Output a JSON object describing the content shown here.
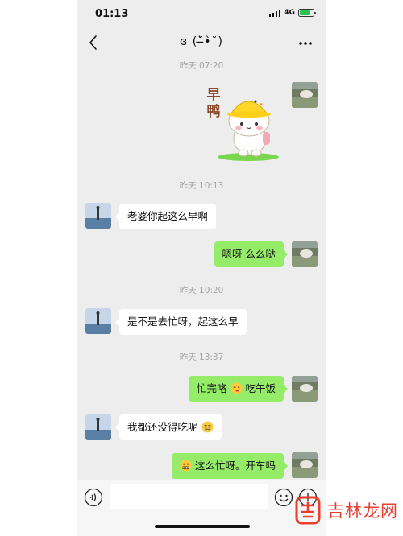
{
  "status_bar": {
    "time": "01:13",
    "network": "4G",
    "battery_level": 0.75
  },
  "nav": {
    "title": "ɞ (˘̶̀•̀˘)"
  },
  "messages": [
    {
      "type": "timestamp",
      "text": "昨天 07:20"
    },
    {
      "type": "sticker",
      "side": "right",
      "sticker_text": "早鸭"
    },
    {
      "type": "timestamp",
      "text": "昨天 10:13"
    },
    {
      "type": "text",
      "side": "left",
      "text": "老婆你起这么早啊"
    },
    {
      "type": "text",
      "side": "right",
      "text": "嗯呀 么么哒"
    },
    {
      "type": "timestamp",
      "text": "昨天 10:20"
    },
    {
      "type": "text",
      "side": "left",
      "text": "是不是去忙呀，起这么早"
    },
    {
      "type": "timestamp",
      "text": "昨天 13:37"
    },
    {
      "type": "text",
      "side": "right",
      "text_before": "忙完咯",
      "emoji": "wink-face",
      "text_after": "吃午饭"
    },
    {
      "type": "text",
      "side": "left",
      "text": "我都还没得吃呢",
      "emoji": "crying-face"
    },
    {
      "type": "text",
      "side": "right",
      "emoji": "grimace-face",
      "text": "这么忙呀。开车吗"
    }
  ],
  "input_bar": {
    "placeholder": ""
  },
  "watermark": {
    "text": "吉林龙网"
  },
  "colors": {
    "chat_bg": "#ededed",
    "outgoing_bubble": "#95ec69",
    "incoming_bubble": "#ffffff",
    "timestamp": "#a3a3a3",
    "watermark": "#e93f2f"
  }
}
